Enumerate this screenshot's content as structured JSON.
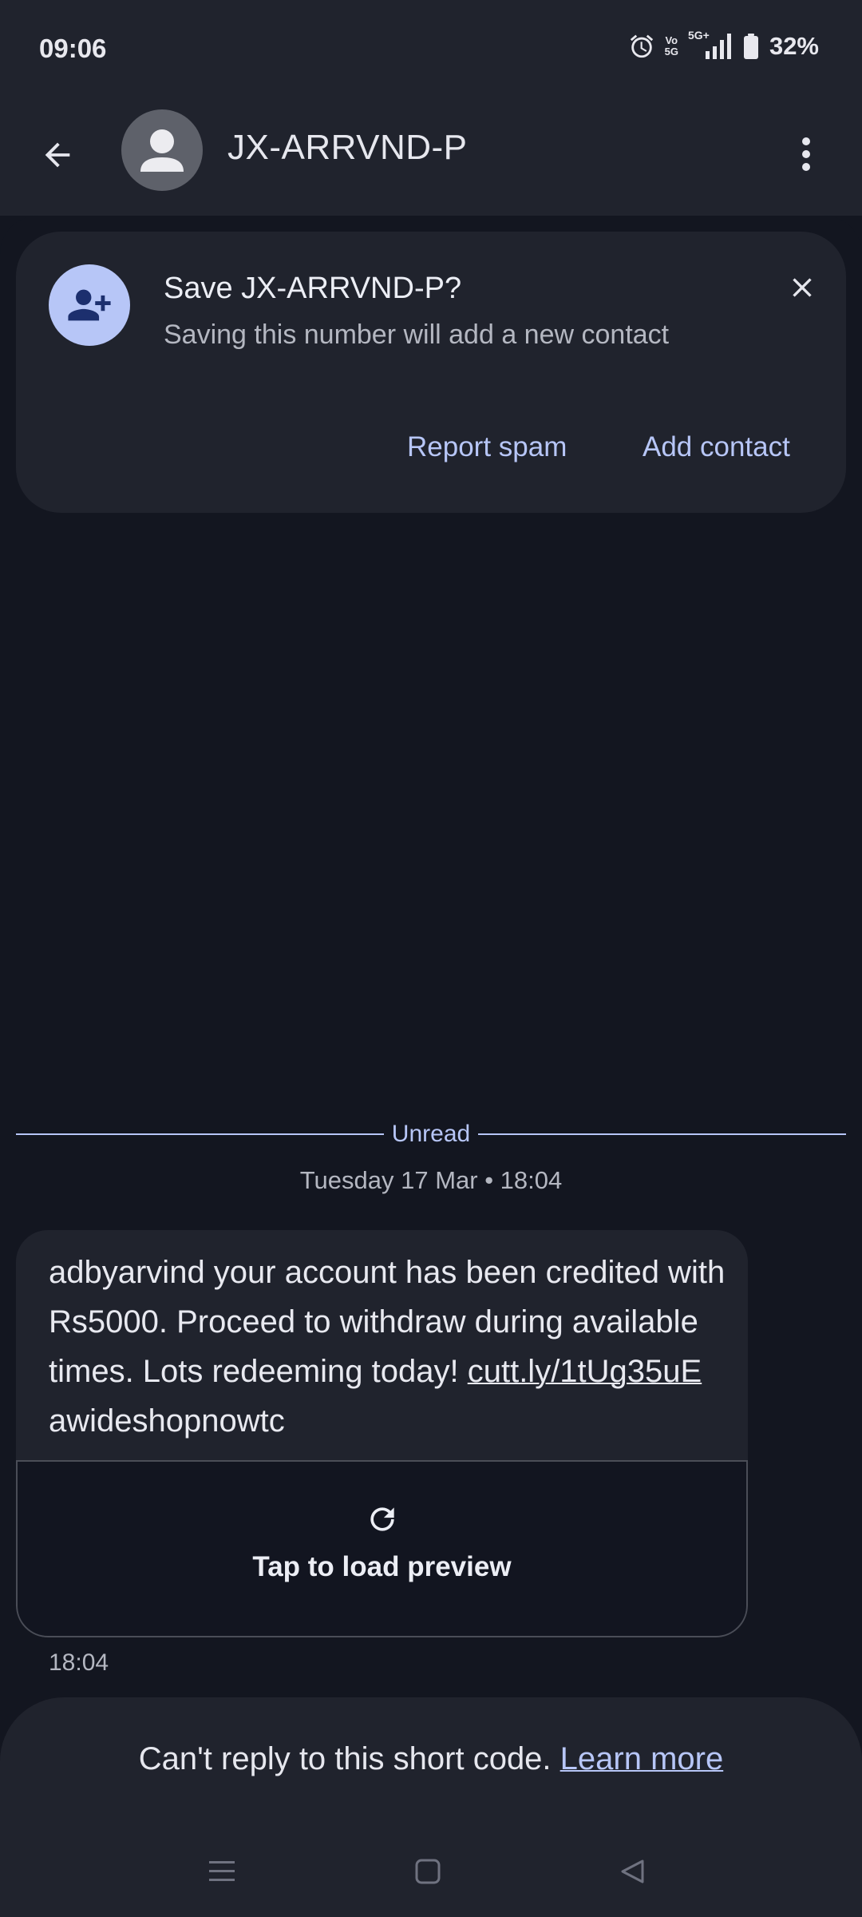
{
  "status_bar": {
    "time": "09:06",
    "volte_top": "Vo",
    "volte_bottom": "5G",
    "network": "5G+",
    "battery": "32%",
    "icons": [
      "alarm-icon",
      "volte-icon",
      "signal-icon",
      "battery-icon"
    ]
  },
  "app_bar": {
    "contact": "JX-ARRVND-P",
    "icons": [
      "back-arrow-icon",
      "avatar-person-icon",
      "more-vert-icon"
    ]
  },
  "save_card": {
    "title": "Save JX-ARRVND-P?",
    "subtitle": "Saving this number will add a new contact",
    "report_label": "Report spam",
    "add_label": "Add contact",
    "icons": [
      "person-add-icon",
      "close-icon"
    ]
  },
  "conversation": {
    "unread_label": "Unread",
    "timestamp": "Tuesday 17 Mar • 18:04",
    "message": {
      "text_before": "adbyarvind your account has been credited with Rs5000. Proceed to withdraw during available times. Lots redeeming today! ",
      "link": "cutt.ly/1tUg35uE",
      "text_after": " awideshopnowtc",
      "preview_label": "Tap to load preview",
      "time": "18:04"
    }
  },
  "compose": {
    "text": "Can't reply to this short code. ",
    "link": "Learn more"
  },
  "nav": {
    "icons": [
      "recents-icon",
      "home-icon",
      "back-icon"
    ]
  },
  "colors": {
    "background": "#131620",
    "surface": "#20232d",
    "accent": "#b7c6f7",
    "text_primary": "#e8e9f0",
    "text_secondary": "#b4b7c1"
  }
}
